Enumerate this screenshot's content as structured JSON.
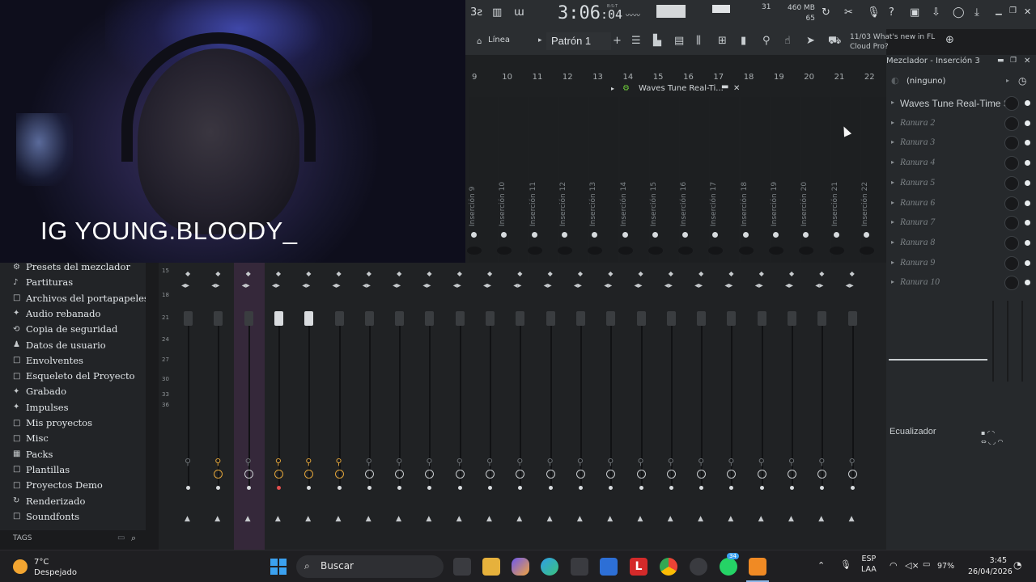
{
  "webcam": {
    "overlay_text": "IG YOUNG.BLOODY_"
  },
  "toolbar": {
    "time": "3:06",
    "time_small": ":04",
    "time_unit": "B:S:T",
    "cpu_value": "31",
    "memory": "460 MB",
    "memory_count": "65",
    "linea_label": "Línea",
    "pattern_label": "Patrón 1",
    "news_text": "11/03  What's new in FL Cloud Pro?"
  },
  "ruler": [
    "9",
    "10",
    "11",
    "12",
    "13",
    "14",
    "15",
    "16",
    "17",
    "18",
    "19",
    "20",
    "21",
    "22"
  ],
  "waves_popup": {
    "label": "Waves Tune Real-Ti..."
  },
  "inserts": [
    "Inserción 9",
    "Inserción 10",
    "Inserción 11",
    "Inserción 12",
    "Inserción 13",
    "Inserción 14",
    "Inserción 15",
    "Inserción 16",
    "Inserción 17",
    "Inserción 18",
    "Inserción 19",
    "Inserción 20",
    "Inserción 21",
    "Inserción 22"
  ],
  "db_scale": [
    "15",
    "18",
    "21",
    "24",
    "27",
    "30",
    "33",
    "36"
  ],
  "browser": {
    "items": [
      {
        "icon": "presets-icon",
        "glyph": "⚙",
        "label": "Presets del mezclador"
      },
      {
        "icon": "music-note-icon",
        "glyph": "♪",
        "label": "Partituras"
      },
      {
        "icon": "folder-icon",
        "glyph": "□",
        "label": "Archivos del portapapeles"
      },
      {
        "icon": "audio-icon",
        "glyph": "✦",
        "label": "Audio rebanado"
      },
      {
        "icon": "backup-icon",
        "glyph": "⟲",
        "label": "Copia de seguridad"
      },
      {
        "icon": "user-icon",
        "glyph": "♟",
        "label": "Datos de usuario"
      },
      {
        "icon": "folder-icon",
        "glyph": "□",
        "label": "Envolventes"
      },
      {
        "icon": "folder-icon",
        "glyph": "□",
        "label": "Esqueleto del Proyecto"
      },
      {
        "icon": "record-icon",
        "glyph": "✦",
        "label": "Grabado"
      },
      {
        "icon": "impulse-icon",
        "glyph": "✦",
        "label": "Impulses"
      },
      {
        "icon": "folder-icon",
        "glyph": "□",
        "label": "Mis proyectos"
      },
      {
        "icon": "folder-icon",
        "glyph": "□",
        "label": "Misc"
      },
      {
        "icon": "packs-icon",
        "glyph": "▦",
        "label": "Packs"
      },
      {
        "icon": "folder-icon",
        "glyph": "□",
        "label": "Plantillas"
      },
      {
        "icon": "folder-icon",
        "glyph": "□",
        "label": "Proyectos Demo"
      },
      {
        "icon": "render-icon",
        "glyph": "↻",
        "label": "Renderizado"
      },
      {
        "icon": "folder-icon",
        "glyph": "□",
        "label": "Soundfonts"
      }
    ],
    "tags_label": "TAGS"
  },
  "right_panel": {
    "title": "Mezclador - Inserción 3",
    "input_selector": "(ninguno)",
    "slots": [
      "Waves Tune Real-Time S...",
      "Ranura 2",
      "Ranura 3",
      "Ranura 4",
      "Ranura 5",
      "Ranura 6",
      "Ranura 7",
      "Ranura 8",
      "Ranura 9",
      "Ranura 10"
    ],
    "eq_label": "Ecualizador"
  },
  "taskbar": {
    "temperature": "7°C",
    "weather": "Despejado",
    "search_placeholder": "Buscar",
    "language": "ESP",
    "language_sub": "LAA",
    "battery": "97%",
    "time": "3:45",
    "date": "26/04/2026",
    "whatsapp_badge": "34"
  },
  "colors": {
    "accent_orange": "#e1a43a",
    "selected_strip": "#35283a",
    "background": "#1c1d1f"
  }
}
